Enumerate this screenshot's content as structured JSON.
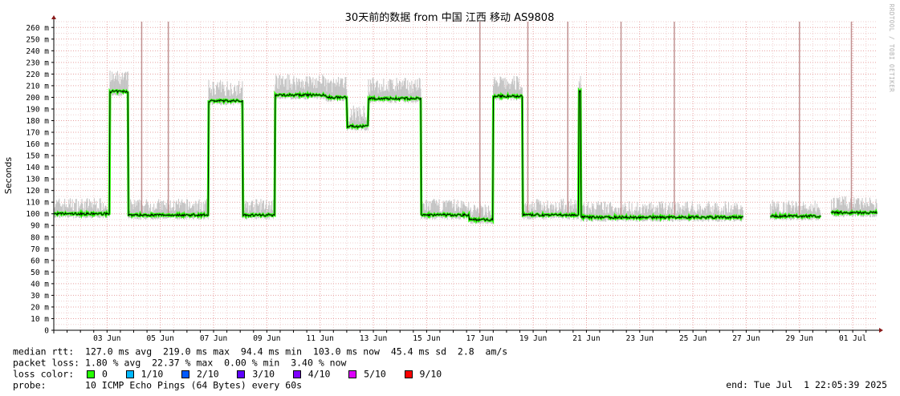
{
  "chart_data": {
    "type": "line",
    "title": "30天前的数据 from 中国 江西 移动 AS9808",
    "ylabel": "Seconds",
    "watermark": "RRDTOOL / TOBI OETIKER",
    "ylim": [
      0,
      265
    ],
    "y_ticks": [
      {
        "v": 0,
        "label": "0"
      },
      {
        "v": 10,
        "label": "10 m"
      },
      {
        "v": 20,
        "label": "20 m"
      },
      {
        "v": 30,
        "label": "30 m"
      },
      {
        "v": 40,
        "label": "40 m"
      },
      {
        "v": 50,
        "label": "50 m"
      },
      {
        "v": 60,
        "label": "60 m"
      },
      {
        "v": 70,
        "label": "70 m"
      },
      {
        "v": 80,
        "label": "80 m"
      },
      {
        "v": 90,
        "label": "90 m"
      },
      {
        "v": 100,
        "label": "100 m"
      },
      {
        "v": 110,
        "label": "110 m"
      },
      {
        "v": 120,
        "label": "120 m"
      },
      {
        "v": 130,
        "label": "130 m"
      },
      {
        "v": 140,
        "label": "140 m"
      },
      {
        "v": 150,
        "label": "150 m"
      },
      {
        "v": 160,
        "label": "160 m"
      },
      {
        "v": 170,
        "label": "170 m"
      },
      {
        "v": 180,
        "label": "180 m"
      },
      {
        "v": 190,
        "label": "190 m"
      },
      {
        "v": 200,
        "label": "200 m"
      },
      {
        "v": 210,
        "label": "210 m"
      },
      {
        "v": 220,
        "label": "220 m"
      },
      {
        "v": 230,
        "label": "230 m"
      },
      {
        "v": 240,
        "label": "240 m"
      },
      {
        "v": 250,
        "label": "250 m"
      },
      {
        "v": 260,
        "label": "260 m"
      }
    ],
    "x_range_days": [
      1.0,
      31.9
    ],
    "x_ticks": [
      {
        "day": 3,
        "label": "03 Jun"
      },
      {
        "day": 5,
        "label": "05 Jun"
      },
      {
        "day": 7,
        "label": "07 Jun"
      },
      {
        "day": 9,
        "label": "09 Jun"
      },
      {
        "day": 11,
        "label": "11 Jun"
      },
      {
        "day": 13,
        "label": "13 Jun"
      },
      {
        "day": 15,
        "label": "15 Jun"
      },
      {
        "day": 17,
        "label": "17 Jun"
      },
      {
        "day": 19,
        "label": "19 Jun"
      },
      {
        "day": 21,
        "label": "21 Jun"
      },
      {
        "day": 23,
        "label": "23 Jun"
      },
      {
        "day": 25,
        "label": "25 Jun"
      },
      {
        "day": 27,
        "label": "27 Jun"
      },
      {
        "day": 29,
        "label": "29 Jun"
      },
      {
        "day": 31,
        "label": "01 Jul"
      }
    ],
    "median_segments": [
      {
        "start": 1.0,
        "end": 3.1,
        "ms": 100
      },
      {
        "start": 3.1,
        "end": 3.8,
        "ms": 205
      },
      {
        "start": 3.8,
        "end": 6.8,
        "ms": 99
      },
      {
        "start": 6.8,
        "end": 8.1,
        "ms": 197
      },
      {
        "start": 8.1,
        "end": 9.3,
        "ms": 99
      },
      {
        "start": 9.3,
        "end": 11.2,
        "ms": 202
      },
      {
        "start": 11.2,
        "end": 12.0,
        "ms": 200
      },
      {
        "start": 12.0,
        "end": 12.8,
        "ms": 175
      },
      {
        "start": 12.8,
        "end": 14.8,
        "ms": 199
      },
      {
        "start": 14.8,
        "end": 16.6,
        "ms": 99
      },
      {
        "start": 16.6,
        "end": 17.5,
        "ms": 95
      },
      {
        "start": 17.5,
        "end": 18.6,
        "ms": 201
      },
      {
        "start": 18.6,
        "end": 20.7,
        "ms": 99
      },
      {
        "start": 20.7,
        "end": 20.8,
        "ms": 205
      },
      {
        "start": 20.8,
        "end": 25.9,
        "ms": 97
      },
      {
        "start": 25.9,
        "end": 27.9,
        "ms": 97
      },
      {
        "start": 27.9,
        "end": 29.8,
        "ms": 98
      },
      {
        "start": 29.8,
        "end": 31.9,
        "ms": 101
      }
    ],
    "data_gaps_days": [
      [
        26.9,
        27.9
      ],
      [
        29.8,
        30.2
      ]
    ],
    "spikes": [
      {
        "day": 4.3,
        "ms": 265
      },
      {
        "day": 5.3,
        "ms": 265
      },
      {
        "day": 17.0,
        "ms": 265
      },
      {
        "day": 18.8,
        "ms": 265
      },
      {
        "day": 20.3,
        "ms": 265
      },
      {
        "day": 22.3,
        "ms": 265
      },
      {
        "day": 24.3,
        "ms": 265
      },
      {
        "day": 29.0,
        "ms": 265
      },
      {
        "day": 30.95,
        "ms": 265
      }
    ],
    "legend": {
      "median_rtt_label": "median rtt:",
      "median_rtt_values": "127.0 ms avg  219.0 ms max  94.4 ms min  103.0 ms now  45.4 ms sd  2.8  am/s",
      "packet_loss_label": "packet loss:",
      "packet_loss_values": "1.80 % avg  22.37 % max  0.00 % min  3.40 % now",
      "loss_color_label": "loss color:",
      "loss_colors": [
        {
          "label": "0",
          "color": "#26ff00"
        },
        {
          "label": "1/10",
          "color": "#00b8ff"
        },
        {
          "label": "2/10",
          "color": "#0059ff"
        },
        {
          "label": "3/10",
          "color": "#5e00ff"
        },
        {
          "label": "4/10",
          "color": "#7e00ff"
        },
        {
          "label": "5/10",
          "color": "#dd00ff"
        },
        {
          "label": "9/10",
          "color": "#ff0000"
        }
      ],
      "probe_label": "probe:",
      "probe_value": "10 ICMP Echo Pings (64 Bytes) every 60s",
      "end_text": "end: Tue Jul  1 22:05:39 2025"
    }
  }
}
